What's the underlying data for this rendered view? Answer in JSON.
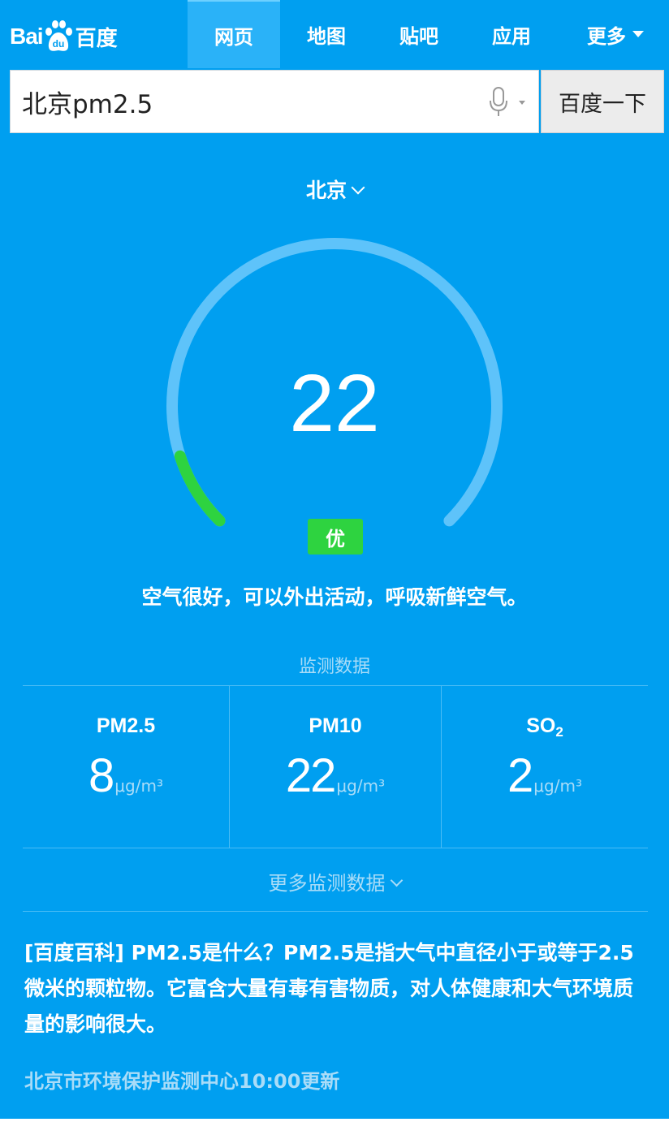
{
  "header": {
    "logo_text": "Bai",
    "logo_du": "du",
    "logo_cn": "百度",
    "tabs": [
      {
        "label": "网页",
        "active": true
      },
      {
        "label": "地图",
        "active": false
      },
      {
        "label": "贴吧",
        "active": false
      },
      {
        "label": "应用",
        "active": false
      },
      {
        "label": "更多",
        "active": false
      }
    ]
  },
  "search": {
    "query": "北京pm2.5",
    "button_label": "百度一下",
    "mic_icon": "microphone-icon"
  },
  "city": {
    "name": "北京"
  },
  "aqi": {
    "value": "22",
    "gauge_fraction": 0.1,
    "level": "优",
    "level_color": "#2ed340",
    "advice": "空气很好，可以外出活动，呼吸新鲜空气。"
  },
  "monitoring": {
    "title": "监测数据",
    "items": [
      {
        "name": "PM2.5",
        "sub": "",
        "value": "8",
        "unit": "μg/m³"
      },
      {
        "name": "PM10",
        "sub": "",
        "value": "22",
        "unit": "μg/m³"
      },
      {
        "name": "SO",
        "sub": "2",
        "value": "2",
        "unit": "μg/m³"
      }
    ],
    "more_label": "更多监测数据"
  },
  "wiki": {
    "tag": "[百度百科]",
    "text": " PM2.5是什么？PM2.5是指大气中直径小于或等于2.5微米的颗粒物。它富含大量有毒有害物质，对人体健康和大气环境质量的影响很大。"
  },
  "source": "北京市环境保护监测中心10:00更新",
  "colors": {
    "background": "#009ff0",
    "active_tab": "#2ab2f8",
    "muted_text": "#a9dcf8",
    "gauge_track": "#5ec3fa",
    "gauge_fill": "#2ed340"
  }
}
